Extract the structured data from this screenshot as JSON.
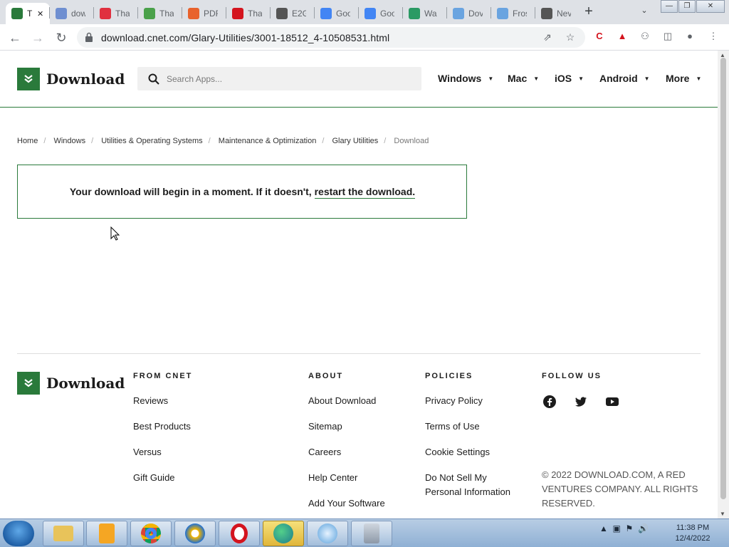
{
  "browser": {
    "tabs": [
      {
        "label": "T",
        "icon": "download-favicon",
        "color": "#2a7a3b",
        "active": true
      },
      {
        "label": "dow",
        "icon": "info-favicon",
        "color": "#6f8fd1"
      },
      {
        "label": "Tha",
        "icon": "opera-favicon",
        "color": "#e0303f"
      },
      {
        "label": "Tha",
        "icon": "utorrent-favicon",
        "color": "#4aa14a"
      },
      {
        "label": "PDF",
        "icon": "pdf-favicon",
        "color": "#e8622c"
      },
      {
        "label": "Tha",
        "icon": "opera-favicon",
        "color": "#d4141e"
      },
      {
        "label": "E2G",
        "icon": "e2g-favicon",
        "color": "#555555"
      },
      {
        "label": "Goo",
        "icon": "google-favicon",
        "color": "#4285f4"
      },
      {
        "label": "Goo",
        "icon": "google-favicon",
        "color": "#4285f4"
      },
      {
        "label": "Wa",
        "icon": "edge-favicon",
        "color": "#2b9a64"
      },
      {
        "label": "Dov",
        "icon": "cloud-favicon",
        "color": "#6aa4e0"
      },
      {
        "label": "Fros",
        "icon": "globe-favicon",
        "color": "#6aa4e0"
      },
      {
        "label": "Nev",
        "icon": "chrome-favicon",
        "color": "#555555"
      }
    ],
    "url": "download.cnet.com/Glary-Utilities/3001-18512_4-10508531.html"
  },
  "site": {
    "logo_text": "Download",
    "search_placeholder": "Search Apps...",
    "nav": [
      "Windows",
      "Mac",
      "iOS",
      "Android",
      "More"
    ]
  },
  "breadcrumb": [
    "Home",
    "Windows",
    "Utilities & Operating Systems",
    "Maintenance & Optimization",
    "Glary Utilities",
    "Download"
  ],
  "notice": {
    "text": "Your download will begin in a moment. If it doesn't, ",
    "link": "restart the download."
  },
  "footer": {
    "logo_text": "Download",
    "from_cnet": {
      "heading": "FROM CNET",
      "links": [
        "Reviews",
        "Best Products",
        "Versus",
        "Gift Guide"
      ]
    },
    "about": {
      "heading": "ABOUT",
      "links": [
        "About Download",
        "Sitemap",
        "Careers",
        "Help Center",
        "Add Your Software"
      ]
    },
    "policies": {
      "heading": "POLICIES",
      "links": [
        "Privacy Policy",
        "Terms of Use",
        "Cookie Settings",
        "Do Not Sell My Personal Information"
      ]
    },
    "follow": {
      "heading": "FOLLOW US",
      "icons": [
        "facebook-icon",
        "twitter-icon",
        "youtube-icon"
      ]
    },
    "copyright": "© 2022 DOWNLOAD.COM, A RED VENTURES COMPANY. ALL RIGHTS RESERVED."
  },
  "taskbar": {
    "apps": [
      "explorer",
      "media-player",
      "chrome",
      "firefox-like",
      "opera",
      "edge",
      "unknown-app",
      "recycle-app"
    ],
    "time": "11:38 PM",
    "date": "12/4/2022"
  }
}
